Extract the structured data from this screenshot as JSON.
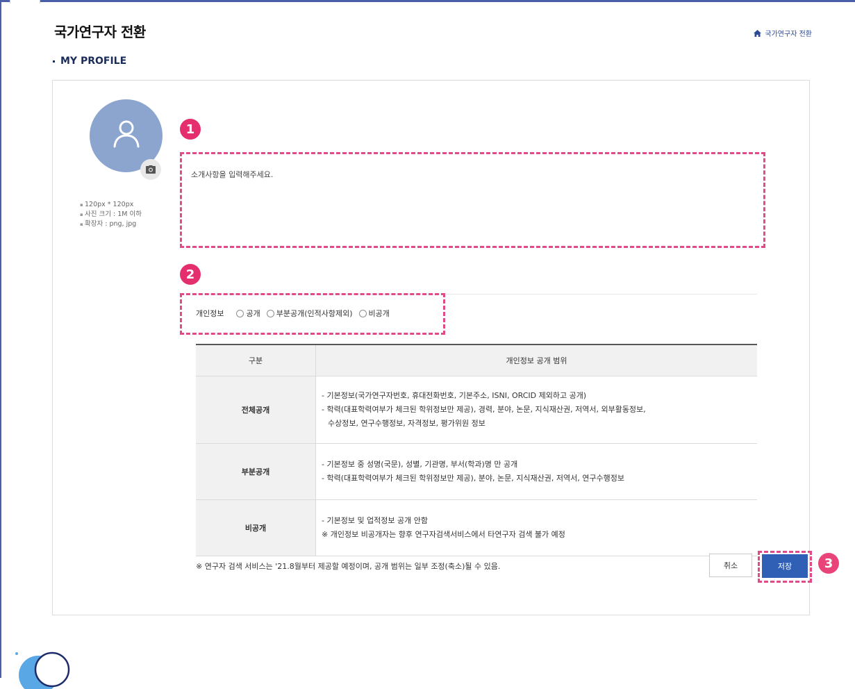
{
  "header": {
    "title": "국가연구자 전환"
  },
  "breadcrumb": {
    "icon": "home-icon",
    "text": "국가연구자 전환"
  },
  "section": {
    "title": "MY PROFILE"
  },
  "profile": {
    "avatar_icon": "user-icon",
    "camera_icon": "camera-icon",
    "photo_guide": [
      "120px * 120px",
      "사진 크기 : 1M 이하",
      "확장자 : png, jpg"
    ]
  },
  "markers": {
    "one": "1",
    "two": "2",
    "three": "3"
  },
  "intro": {
    "placeholder": "소개사항을 입력해주세요.",
    "value": ""
  },
  "privacy": {
    "label": "개인정보",
    "options": [
      "공개",
      "부분공개(인적사항제외)",
      "비공개"
    ],
    "selected": null
  },
  "scope_table": {
    "headers": [
      "구분",
      "개인정보 공개 범위"
    ],
    "rows": [
      {
        "category": "전체공개",
        "lines": [
          "- 기본정보(국가연구자번호, 휴대전화번호, 기본주소, ISNI, ORCID 제외하고 공개)",
          "- 학력(대표학력여부가 체크된 학위정보만 제공), 경력, 분야, 논문, 지식재산권, 저역서, 외부활동정보,",
          "수상정보, 연구수행정보, 자격정보, 평가위원 정보"
        ]
      },
      {
        "category": "부분공개",
        "lines": [
          "- 기본정보 중 성명(국문), 성별, 기관명, 부서(학과)명 만 공개",
          "- 학력(대표학력여부가 체크된 학위정보만 제공), 분야, 논문, 지식재산권, 저역서, 연구수행정보"
        ]
      },
      {
        "category": "비공개",
        "lines": [
          "- 기본정보 및 업적정보 공개 안함",
          "※ 개인정보 비공개자는 향후 연구자검색서비스에서 타연구자 검색 불가 예정"
        ]
      }
    ]
  },
  "footnote": "※ 연구자 검색 서비스는 '21.8월부터 제공할 예정이며, 공개 범위는 일부 조정(축소)될 수 있음.",
  "actions": {
    "cancel": "취소",
    "save": "저장"
  },
  "colors": {
    "accent": "#2f60b6",
    "marker": "#e52e6e",
    "highlight_dash": "#e04a88",
    "avatar": "#8ba5cf"
  }
}
